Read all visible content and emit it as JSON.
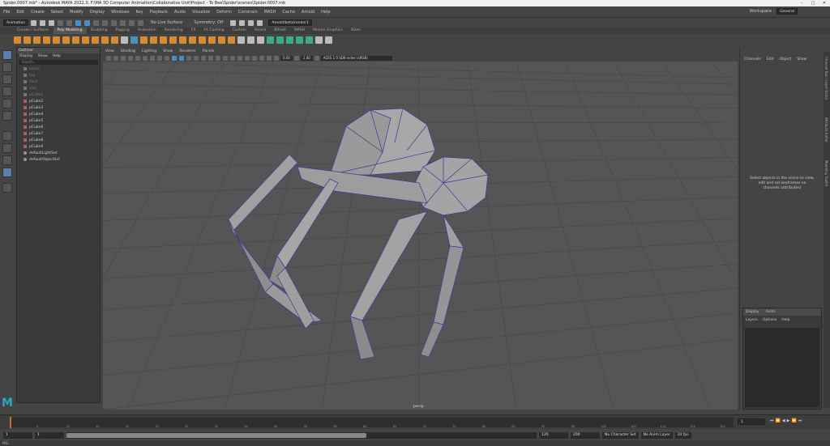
{
  "window": {
    "title": "Spider.0007.mb* - Autodesk MAYA 2022.3: F:\\MA 3D Computer Animation\\Collaborative Unit\\Project - To Bee\\Spider\\scenes\\Spider.0007.mb"
  },
  "menubar": {
    "items": [
      "File",
      "Edit",
      "Create",
      "Select",
      "Modify",
      "Display",
      "Windows",
      "Key",
      "Playback",
      "Audio",
      "Visualize",
      "Deform",
      "Constrain",
      "MASH",
      "Cache",
      "Arnold",
      "Help"
    ]
  },
  "workspace": {
    "label": "Workspace :",
    "value": "General"
  },
  "statusline": {
    "mode_menu": "Animation",
    "live_surface": "No Live Surface",
    "symmetry": "Symmetry: Off",
    "renderer": "Arnold/beta/render1"
  },
  "shelf": {
    "tabs": [
      "Curves / Surfaces",
      "Poly Modeling",
      "Sculpting",
      "Rigging",
      "Animation",
      "Rendering",
      "FX",
      "FX Caching",
      "Custom",
      "Arnold",
      "Bifrost",
      "MASH",
      "Motion Graphics",
      "XGen"
    ],
    "active": "Poly Modeling"
  },
  "outliner": {
    "title": "Outliner",
    "menu": [
      "Display",
      "Show",
      "Help"
    ],
    "search_placeholder": "Search...",
    "items": [
      {
        "label": "persp",
        "dim": true,
        "kind": "cam"
      },
      {
        "label": "top",
        "dim": true,
        "kind": "cam"
      },
      {
        "label": "front",
        "dim": true,
        "kind": "cam"
      },
      {
        "label": "side",
        "dim": true,
        "kind": "cam"
      },
      {
        "label": "pCube1",
        "dim": true,
        "kind": "cam"
      },
      {
        "label": "pCube2",
        "dim": false,
        "kind": "mesh"
      },
      {
        "label": "pCube3",
        "dim": false,
        "kind": "mesh"
      },
      {
        "label": "pCube4",
        "dim": false,
        "kind": "mesh"
      },
      {
        "label": "pCube5",
        "dim": false,
        "kind": "mesh"
      },
      {
        "label": "pCube6",
        "dim": false,
        "kind": "mesh"
      },
      {
        "label": "pCube7",
        "dim": false,
        "kind": "mesh"
      },
      {
        "label": "pCube8",
        "dim": false,
        "kind": "mesh"
      },
      {
        "label": "pCube9",
        "dim": false,
        "kind": "mesh"
      },
      {
        "label": "defaultLightSet",
        "dim": false,
        "kind": "set"
      },
      {
        "label": "defaultObjectSet",
        "dim": false,
        "kind": "set"
      }
    ]
  },
  "viewport": {
    "menu": [
      "View",
      "Shading",
      "Lighting",
      "Show",
      "Renderer",
      "Panels"
    ],
    "near_value": "0.00",
    "far_value": "1.00",
    "color_space": "ACES 1.0 SDR-video (sRGB)",
    "camera": "persp"
  },
  "channelbox": {
    "menu": [
      "Channels",
      "Edit",
      "Object",
      "Show"
    ],
    "message": "Select objects in the scene to view, edit and set keyframes on channels (attributes)"
  },
  "layers": {
    "tabs": [
      "Display",
      "Anim"
    ],
    "menu": [
      "Layers",
      "Options",
      "Help"
    ]
  },
  "side_tabs": [
    "Channel Box / Layer Editor",
    "Attribute Editor",
    "Modeling Toolkit"
  ],
  "timeslider": {
    "current_frame": "1",
    "ticks": [
      "5",
      "10",
      "15",
      "20",
      "25",
      "30",
      "35",
      "40",
      "45",
      "50",
      "55",
      "60",
      "65",
      "70",
      "75",
      "80",
      "85",
      "90",
      "95",
      "100",
      "105",
      "110",
      "115",
      "120"
    ]
  },
  "range": {
    "start": "1",
    "playback_start": "1",
    "range_value": "120",
    "playback_end": "120",
    "end": "200",
    "character_set": "No Character Set",
    "anim_layer": "No Anim Layer",
    "fps": "24 fps"
  },
  "cmdline": {
    "label": "MEL"
  }
}
